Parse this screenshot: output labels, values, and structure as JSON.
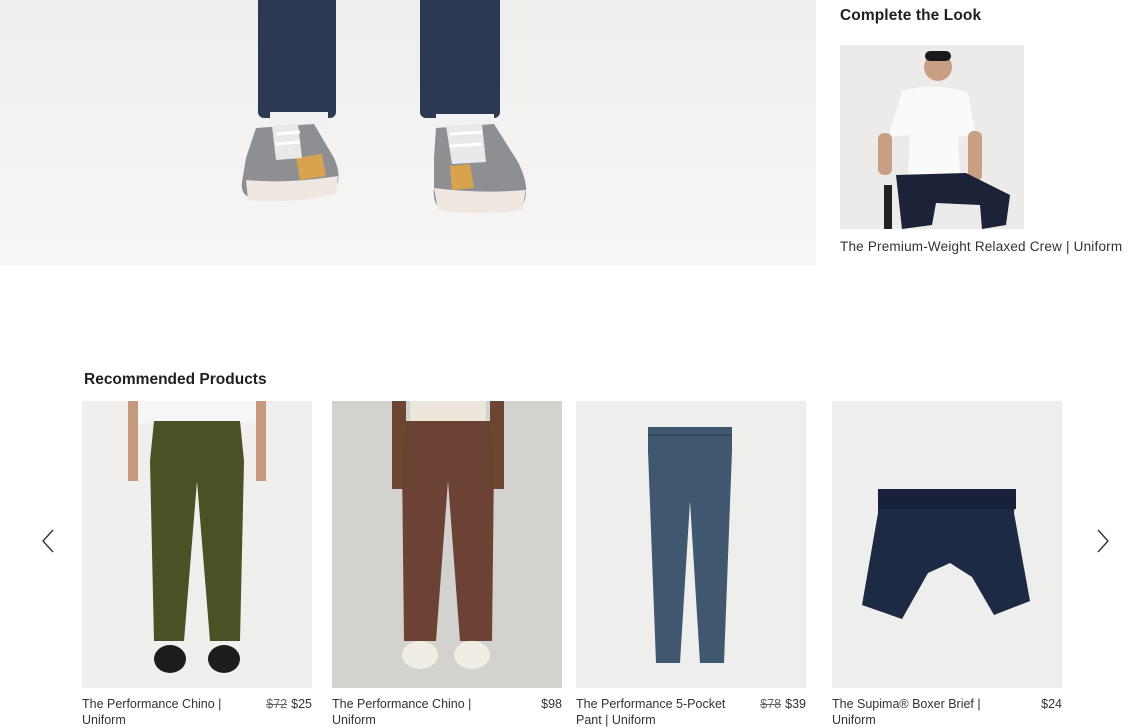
{
  "complete_the_look": {
    "title": "Complete the Look",
    "item_caption": "The Premium-Weight Relaxed Crew | Uniform"
  },
  "recommended": {
    "title": "Recommended Products",
    "items": [
      {
        "name": "The Performance Chino | Uniform",
        "old_price": "$72",
        "price": "$25",
        "color": "#4a5124"
      },
      {
        "name": "The Performance Chino | Uniform",
        "old_price": "",
        "price": "$98",
        "color": "#6b4234"
      },
      {
        "name": "The Performance 5-Pocket Pant | Uniform",
        "old_price": "$78",
        "price": "$39",
        "color": "#3f5870"
      },
      {
        "name": "The Supima® Boxer Brief | Uniform",
        "old_price": "",
        "price": "$24",
        "color": "#1d2a44"
      }
    ]
  },
  "icons": {
    "prev": "chevron-left-icon",
    "next": "chevron-right-icon"
  }
}
